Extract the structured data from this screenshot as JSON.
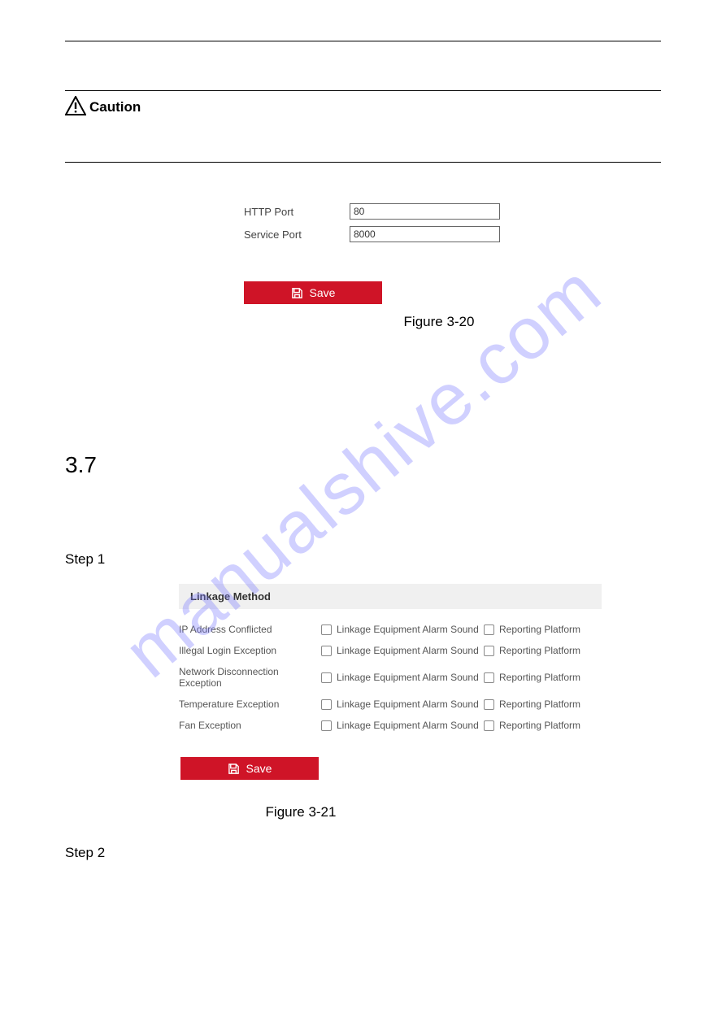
{
  "watermark": "manualshive.com",
  "caution": {
    "label": "Caution"
  },
  "port": {
    "http_label": "HTTP Port",
    "http_value": "80",
    "service_label": "Service Port",
    "service_value": "8000",
    "save_label": "Save",
    "figure_caption": "Figure 3-20"
  },
  "section": {
    "num": "3.7"
  },
  "step1": {
    "label": "Step 1"
  },
  "linkage": {
    "header": "Linkage Method",
    "rows": [
      {
        "name": "IP Address Conflicted",
        "opt1": "Linkage Equipment Alarm Sound",
        "opt2": "Reporting Platform"
      },
      {
        "name": "Illegal Login Exception",
        "opt1": "Linkage Equipment Alarm Sound",
        "opt2": "Reporting Platform"
      },
      {
        "name": "Network Disconnection Exception",
        "opt1": "Linkage Equipment Alarm Sound",
        "opt2": "Reporting Platform"
      },
      {
        "name": "Temperature Exception",
        "opt1": "Linkage Equipment Alarm Sound",
        "opt2": "Reporting Platform"
      },
      {
        "name": "Fan Exception",
        "opt1": "Linkage Equipment Alarm Sound",
        "opt2": "Reporting Platform"
      }
    ],
    "save_label": "Save",
    "figure_caption": "Figure 3-21"
  },
  "step2": {
    "label": "Step 2"
  }
}
